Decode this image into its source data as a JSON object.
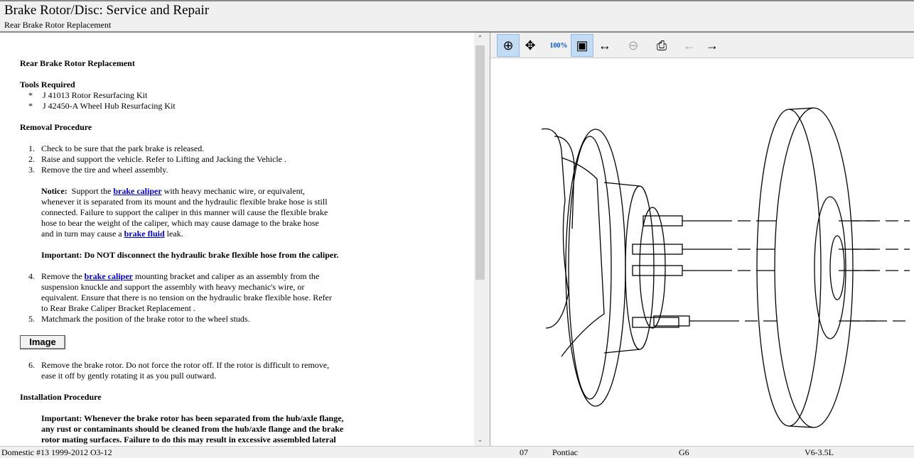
{
  "header": {
    "title": "Brake Rotor/Disc:  Service and Repair",
    "subtitle": "Rear Brake Rotor Replacement"
  },
  "doc": {
    "heading": "Rear Brake Rotor Replacement",
    "tools_heading": "Tools Required",
    "tools": [
      "J 41013 Rotor Resurfacing Kit",
      "J 42450-A Wheel Hub Resurfacing Kit"
    ],
    "bullet": "*",
    "removal_heading": "Removal Procedure",
    "steps": [
      "Check to be sure that the park brake is released.",
      "Raise and support the vehicle. Refer to  Lifting and Jacking the Vehicle .",
      "Remove the tire and wheel assembly."
    ],
    "nums": [
      "1.",
      "2.",
      "3.",
      "4.",
      "5.",
      "6."
    ],
    "notice_label": "Notice:",
    "notice": [
      "Support the ",
      "brake caliper",
      " with heavy mechanic wire, or equivalent,",
      "whenever it is separated from its mount and the hydraulic flexible brake hose is still",
      "connected. Failure to support the caliper in this manner will cause the flexible brake",
      "hose to bear the weight of the caliper, which may cause damage to the brake hose",
      "and in turn may cause a ",
      "brake fluid",
      " leak."
    ],
    "important1": "Important:  Do NOT disconnect the hydraulic brake flexible hose from the caliper.",
    "step4": [
      "Remove the ",
      "brake caliper",
      " mounting bracket and caliper as an assembly from the",
      "suspension knuckle and support the assembly with heavy mechanic's wire, or",
      "equivalent. Ensure that there is no tension on the hydraulic brake flexible hose. Refer",
      "to  Rear Brake Caliper Bracket Replacement ."
    ],
    "step5": "Matchmark the position of the brake rotor to the wheel studs.",
    "image_button": "Image",
    "step6": [
      "Remove the brake rotor. Do not force the rotor off. If the rotor is difficult to remove,",
      "ease it off by gently rotating it as you pull outward."
    ],
    "install_heading": "Installation Procedure",
    "important2": [
      "Important:  Whenever the brake rotor has been separated from the hub/axle flange,",
      "any rust or contaminants should be cleaned from the hub/axle flange and the brake",
      "rotor mating surfaces. Failure to do this may result in excessive assembled lateral"
    ]
  },
  "toolbar": [
    "zoom-in",
    "pan",
    "zoom-100",
    "zoom-fit",
    "zoom-width",
    "zoom-out",
    "print",
    "previous-image",
    "next-image"
  ],
  "status": {
    "source": "Domestic #13 1999-2012 O3-12",
    "year": "07",
    "make": "Pontiac",
    "model": "G6",
    "engine": "V6-3.5L"
  }
}
